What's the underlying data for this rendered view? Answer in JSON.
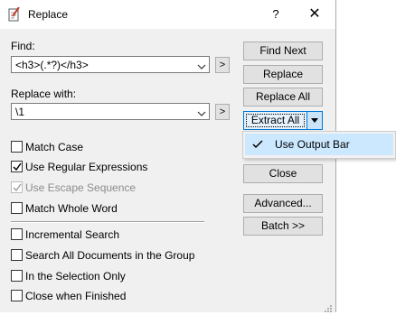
{
  "window": {
    "title": "Replace",
    "help_glyph": "?",
    "close_glyph": "✕"
  },
  "find": {
    "label": "Find:",
    "value": "<h3>(.*?)</h3>",
    "more_glyph": ">"
  },
  "replace": {
    "label": "Replace with:",
    "value": "\\1",
    "more_glyph": ">"
  },
  "options": [
    {
      "label": "Match Case",
      "checked": false,
      "disabled": false
    },
    {
      "label": "Use Regular Expressions",
      "checked": true,
      "disabled": false
    },
    {
      "label": "Use Escape Sequence",
      "checked": true,
      "disabled": true
    },
    {
      "label": "Match Whole Word",
      "checked": false,
      "disabled": false
    },
    {
      "label": "Incremental Search",
      "checked": false,
      "disabled": false
    },
    {
      "label": "Search All Documents in the Group",
      "checked": false,
      "disabled": false
    },
    {
      "label": "In the Selection Only",
      "checked": false,
      "disabled": false
    },
    {
      "label": "Close when Finished",
      "checked": false,
      "disabled": false
    }
  ],
  "buttons": {
    "find_next": "Find Next",
    "replace": "Replace",
    "replace_all": "Replace All",
    "extract_all": "Extract All",
    "close": "Close",
    "advanced": "Advanced...",
    "batch": "Batch >>"
  },
  "extract_menu": {
    "item": "Use Output Bar",
    "checked": true
  },
  "colors": {
    "accent": "#0078d7",
    "menu_highlight": "#cce8ff",
    "dialog_bg": "#f0f0f0"
  }
}
